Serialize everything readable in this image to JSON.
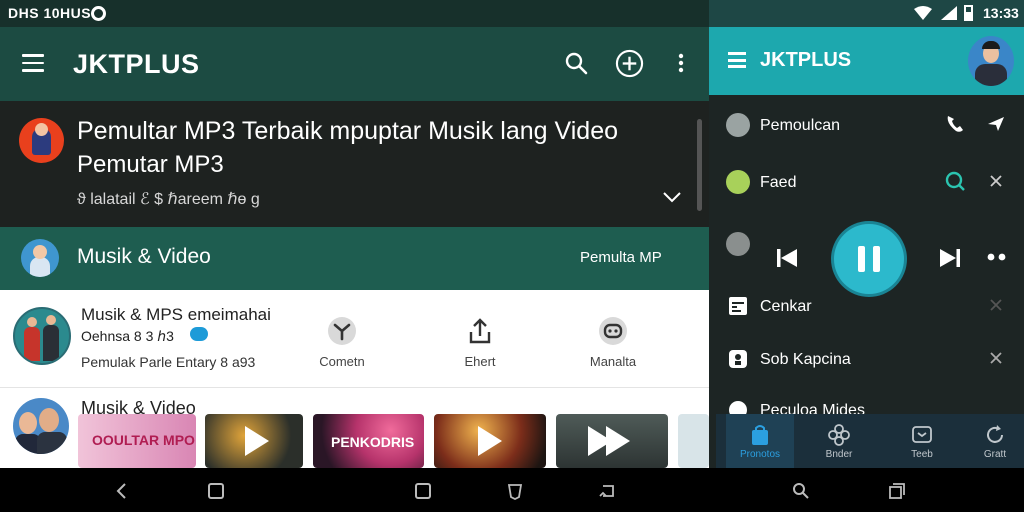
{
  "left_status": {
    "text": "DHS 10HUS"
  },
  "app_bar": {
    "title": "JKTPLUS"
  },
  "featured": {
    "title_line1": "Pemultar MP3 Terbaik mpuptar Musik lang Video",
    "title_line2": "Pemutar MP3",
    "meta": "ϑ lalatail ℰ $ ℏareem ℏɵ ɡ"
  },
  "banner": {
    "label": "Musik & Video",
    "right_text": "Pemulta MP"
  },
  "row1": {
    "title": "Musik & MPS emeimahai",
    "subtitle": "Oehnsa  8 3 ℎ3",
    "meta": "Pemulak  Parle Entary 8 a93",
    "actions": [
      {
        "label": "Cometn",
        "icon": "filter-icon"
      },
      {
        "label": "Ehert",
        "icon": "share-icon"
      },
      {
        "label": "Manalta",
        "icon": "message-icon"
      }
    ]
  },
  "row2": {
    "title": "Musik & Video",
    "thumbnails": [
      {
        "caption": "OOULTAR MPO",
        "bg": "#d986b4"
      },
      {
        "caption": "",
        "bg": "#2b2f2a"
      },
      {
        "caption": "PENKODRIS",
        "bg": "#b6336b"
      },
      {
        "caption": "",
        "bg": "#7c2d1a"
      },
      {
        "caption": "",
        "bg": "#2d3433"
      }
    ]
  },
  "right_status": {
    "time": "13:33"
  },
  "right_app_bar": {
    "title": "JKTPLUS"
  },
  "right_items": [
    {
      "label": "Pemoulcan",
      "icon_color": "#9aa3a2"
    },
    {
      "label": "Faed",
      "icon_color": "#a8d15a"
    },
    {
      "label": "",
      "icon_color": "#8a8f8e"
    },
    {
      "label": "Cenkar",
      "icon_color": ""
    },
    {
      "label": "Sob Kapcina",
      "icon_color": ""
    },
    {
      "label": "Peculoa Mides",
      "icon_color": ""
    }
  ],
  "right_tabs": [
    {
      "label": "Pronotos",
      "icon": "bag-icon"
    },
    {
      "label": "Bnder",
      "icon": "flower-icon"
    },
    {
      "label": "Teeb",
      "icon": "tv-icon"
    },
    {
      "label": "Gratt",
      "icon": "refresh-icon"
    }
  ],
  "colors": {
    "left_appbar": "#1c4b42",
    "banner": "#1e5d50",
    "right_appbar": "#1da8ae",
    "accent_blue": "#2b9fe0",
    "pause_button": "#2cb9cc"
  }
}
